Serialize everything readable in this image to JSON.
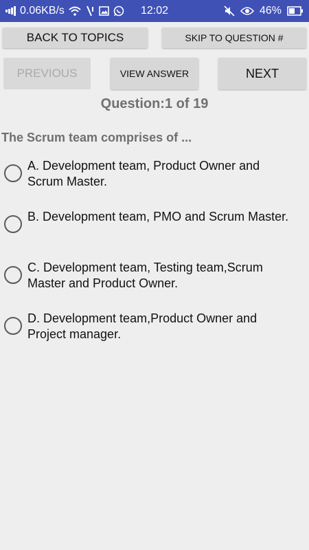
{
  "status_bar": {
    "network_speed": "0.06KB/s",
    "time": "12:02",
    "battery": "46%",
    "icons": [
      "signal-icon",
      "wifi-icon",
      "data-transfer-icon",
      "image-icon",
      "whatsapp-icon",
      "mute-icon",
      "eye-icon",
      "battery-icon"
    ]
  },
  "toolbar": {
    "back_label": "BACK TO TOPICS",
    "skip_label": "SKIP TO QUESTION #",
    "previous_label": "PREVIOUS",
    "view_answer_label": "VIEW ANSWER",
    "next_label": "NEXT"
  },
  "question": {
    "counter": "Question:1 of 19",
    "text": "The Scrum team comprises of ...",
    "options": [
      {
        "label": "A. Development team, Product Owner and Scrum Master."
      },
      {
        "label": "B. Development team, PMO and Scrum Master."
      },
      {
        "label": "C. Development team, Testing team,Scrum Master and Product Owner."
      },
      {
        "label": "D. Development team,Product Owner and Project manager."
      }
    ]
  },
  "colors": {
    "status_bar": "#3f51b5",
    "background": "#eeeeee",
    "button": "#d7d7d7"
  }
}
